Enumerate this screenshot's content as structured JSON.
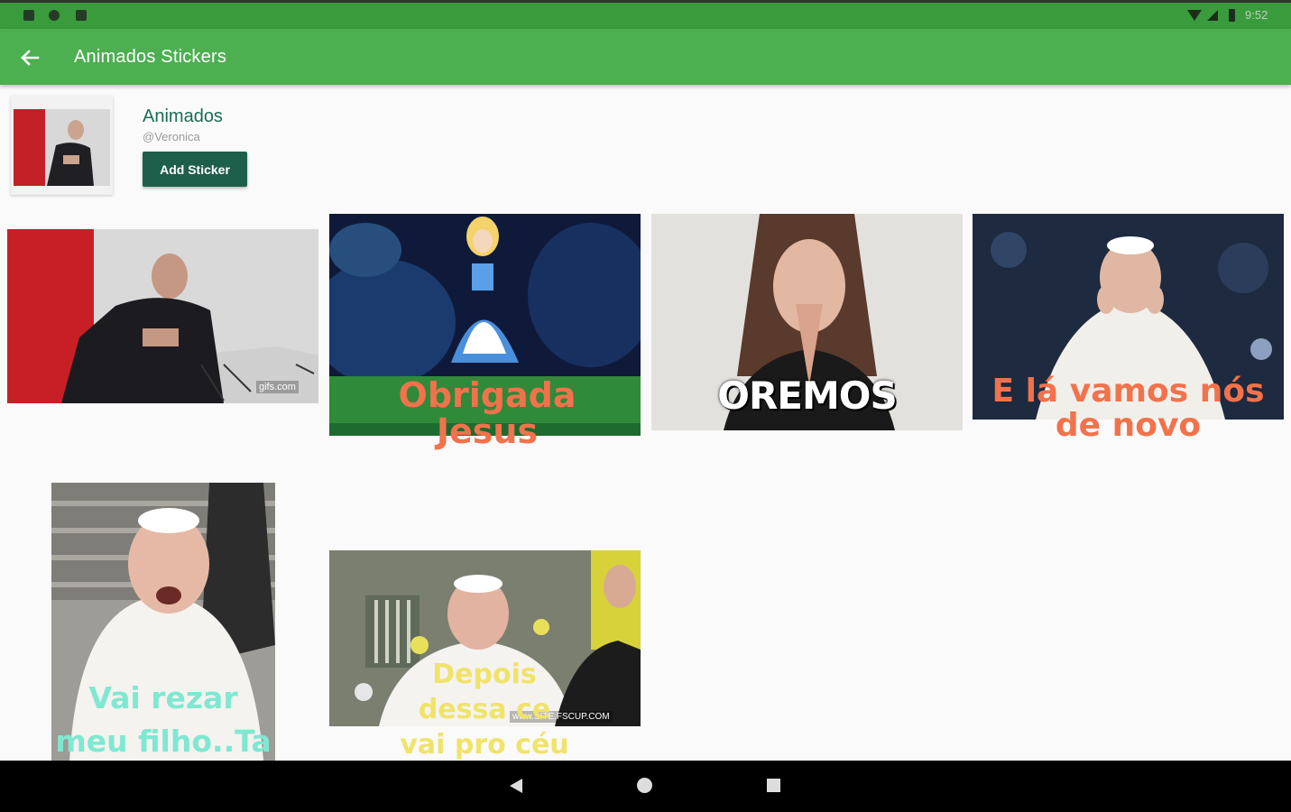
{
  "status_bar": {
    "time": "9:52"
  },
  "app_bar": {
    "title": "Animados Stickers",
    "back_icon": "arrow-left-icon"
  },
  "pack": {
    "name": "Animados",
    "publisher": "@Veronica",
    "add_button_label": "Add Sticker"
  },
  "stickers": [
    {
      "caption": "",
      "watermark": "gifs.com"
    },
    {
      "caption": "Obrigada Jesus",
      "caption_color": "#f2724b"
    },
    {
      "caption": "OREMOS",
      "caption_color": "#ffffff"
    },
    {
      "caption": "E lá vamos nós de novo",
      "caption_color": "#f2724b"
    },
    {
      "caption": "Vai rezar meu filho..Ta",
      "caption_color": "#7fe8d0"
    },
    {
      "caption": "Depois dessa ce vai pro céu",
      "caption_color": "#f0e36a",
      "watermark": "www.SITE.FSCUP.COM"
    }
  ],
  "colors": {
    "status_bar": "#3a9b3c",
    "app_bar": "#4caf50",
    "button": "#1e5f4b",
    "title_text": "#1b6c55"
  }
}
